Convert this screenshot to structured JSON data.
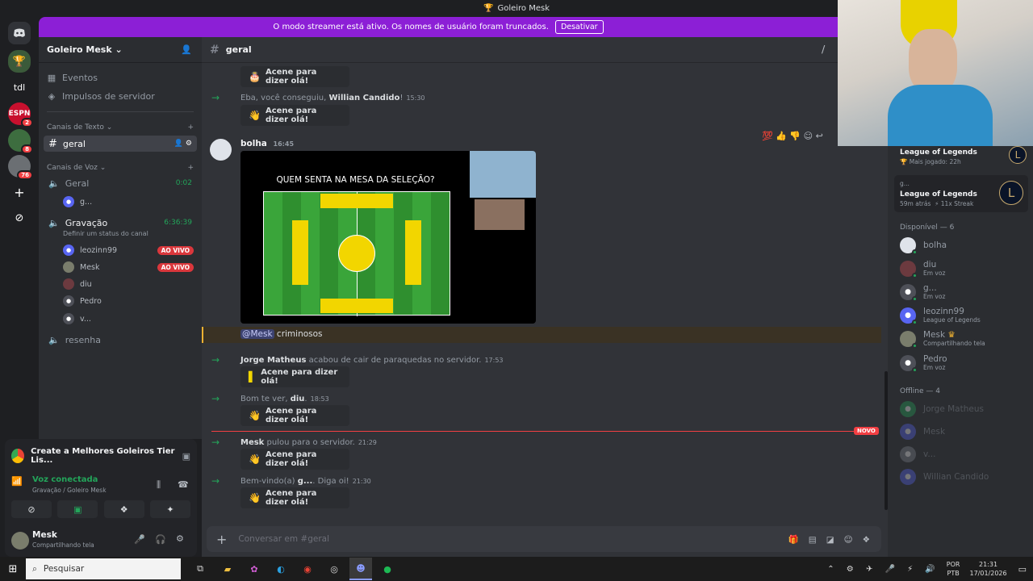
{
  "window": {
    "title": "Goleiro Mesk"
  },
  "banner": {
    "text": "O modo streamer está ativo. Os nomes de usuário foram truncados.",
    "button": "Desativar"
  },
  "servers": [
    {
      "label": "tdl"
    },
    {
      "label": "ESPN",
      "badge": "2"
    },
    {
      "label": "",
      "badge": "8"
    },
    {
      "label": "",
      "badge": "76"
    }
  ],
  "sidebar": {
    "server_name": "Goleiro Mesk",
    "events": "Eventos",
    "boosts": "Impulsos de servidor",
    "text_category": "Canais de Texto",
    "selected_channel": "geral",
    "voice_category": "Canais de Voz",
    "voice_channels": [
      {
        "name": "Geral",
        "time": "0:02",
        "users": [
          "g..."
        ]
      },
      {
        "name": "Gravação",
        "time": "6:36:39",
        "status": "Definir um status do canal",
        "users": [
          {
            "name": "leozinn99",
            "live": "AO VIVO"
          },
          {
            "name": "Mesk",
            "live": "AO VIVO"
          },
          {
            "name": "diu"
          },
          {
            "name": "Pedro"
          },
          {
            "name": "v..."
          }
        ]
      }
    ],
    "other_channel": "resenha"
  },
  "call": {
    "activity": "Create a Melhores Goleiros Tier Lis...",
    "status": "Voz conectada",
    "location": "Gravação / Goleiro Mesk"
  },
  "user": {
    "name": "Mesk",
    "status": "Compartilhando tela"
  },
  "chat": {
    "channel": "geral",
    "wave_label": "Acene para dizer olá!",
    "sys1": {
      "pre": "Eba, você conseguiu,",
      "name": "Willian Candido",
      "post": "!",
      "time": "15:30"
    },
    "msg": {
      "author": "bolha",
      "time": "16:45",
      "mention": "@Mesk",
      "text": "criminosos",
      "image_title": "QUEM SENTA NA MESA DA SELEÇÃO?"
    },
    "sys2": {
      "name": "Jorge Matheus",
      "text": "acabou de cair de paraquedas no servidor.",
      "time": "17:53"
    },
    "sys3": {
      "pre": "Bom te ver,",
      "name": "diu",
      "post": ".",
      "time": "18:53"
    },
    "sys4": {
      "name": "Mesk",
      "text": "pulou para o servidor.",
      "time": "21:29"
    },
    "sys5": {
      "pre": "Bem-vindo(a)",
      "name": "g...",
      "post": ". Diga oi!",
      "time": "21:30"
    },
    "new_label": "NOVO",
    "composer_placeholder": "Conversar em #geral"
  },
  "members": {
    "activities": [
      {
        "game": "League of Legends",
        "sub": "Mais jogado: 22h"
      },
      {
        "name": "g...",
        "game": "League of Legends",
        "sub": "59m atrás",
        "streak": "11x Streak"
      }
    ],
    "online_header": "Disponível — 6",
    "online": [
      {
        "name": "bolha",
        "sub": ""
      },
      {
        "name": "diu",
        "sub": "Em voz"
      },
      {
        "name": "g...",
        "sub": "Em voz"
      },
      {
        "name": "leozinn99",
        "sub": "League of Legends"
      },
      {
        "name": "Mesk",
        "sub": "Compartilhando tela"
      },
      {
        "name": "Pedro",
        "sub": "Em voz"
      }
    ],
    "offline_header": "Offline — 4",
    "offline": [
      "Jorge Matheus",
      "Mesk",
      "v...",
      "Willian Candido"
    ]
  },
  "taskbar": {
    "search": "Pesquisar",
    "lang1": "POR",
    "lang2": "PTB",
    "time": "21:31",
    "date": "17/01/2026"
  }
}
